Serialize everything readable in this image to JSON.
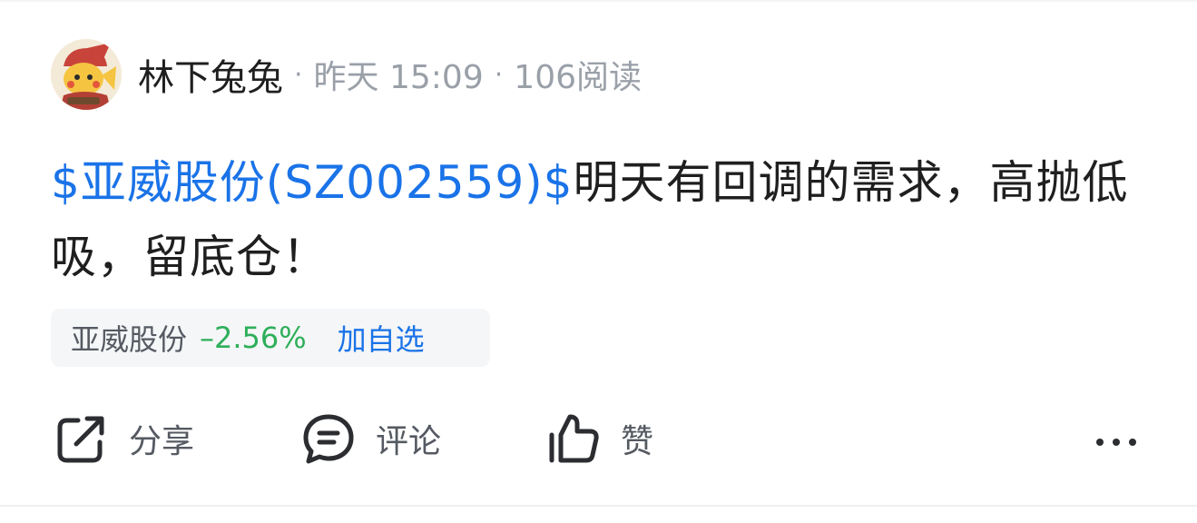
{
  "post": {
    "author": {
      "name": "林下兔兔",
      "avatar_icon": "pikachu-avatar-icon"
    },
    "separator": "·",
    "time": "昨天 15:09",
    "reads": "106阅读",
    "stock_link": "$亚威股份(SZ002559)$",
    "text": "明天有回调的需求，高抛低吸，留底仓！"
  },
  "stock_chip": {
    "name": "亚威股份",
    "change": "–2.56%",
    "change_color": "#2eaf5a",
    "add_label": "加自选"
  },
  "actions": {
    "share": {
      "label": "分享",
      "icon": "share-icon"
    },
    "comment": {
      "label": "评论",
      "icon": "comment-icon"
    },
    "like": {
      "label": "赞",
      "icon": "thumbs-up-icon"
    },
    "more": {
      "icon": "more-icon"
    }
  },
  "colors": {
    "link": "#1a73e8",
    "text": "#1f1f1f",
    "muted": "#9aa0a8"
  }
}
